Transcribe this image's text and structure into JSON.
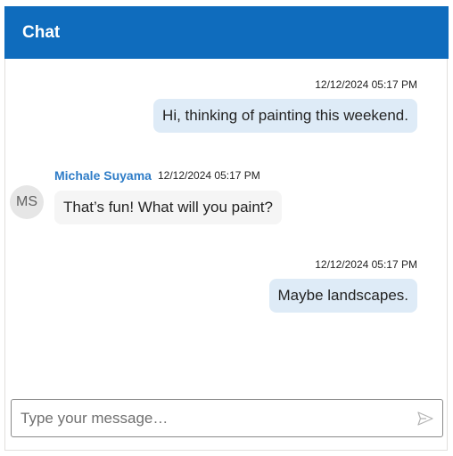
{
  "header": {
    "title": "Chat"
  },
  "messages": [
    {
      "direction": "outgoing",
      "timestamp": "12/12/2024 05:17 PM",
      "text": "Hi, thinking of painting this weekend."
    },
    {
      "direction": "incoming",
      "sender": "Michale Suyama",
      "avatar_initials": "MS",
      "timestamp": "12/12/2024 05:17 PM",
      "text": "That’s fun! What will you paint?"
    },
    {
      "direction": "outgoing",
      "timestamp": "12/12/2024 05:17 PM",
      "text": "Maybe landscapes."
    }
  ],
  "composer": {
    "placeholder": "Type your message…",
    "value": "",
    "send_icon": "send-icon"
  },
  "colors": {
    "header_bg": "#0f6cbd",
    "outgoing_bubble": "#deebf7",
    "incoming_bubble": "#f5f5f5",
    "sender_name": "#2e7cc7"
  }
}
